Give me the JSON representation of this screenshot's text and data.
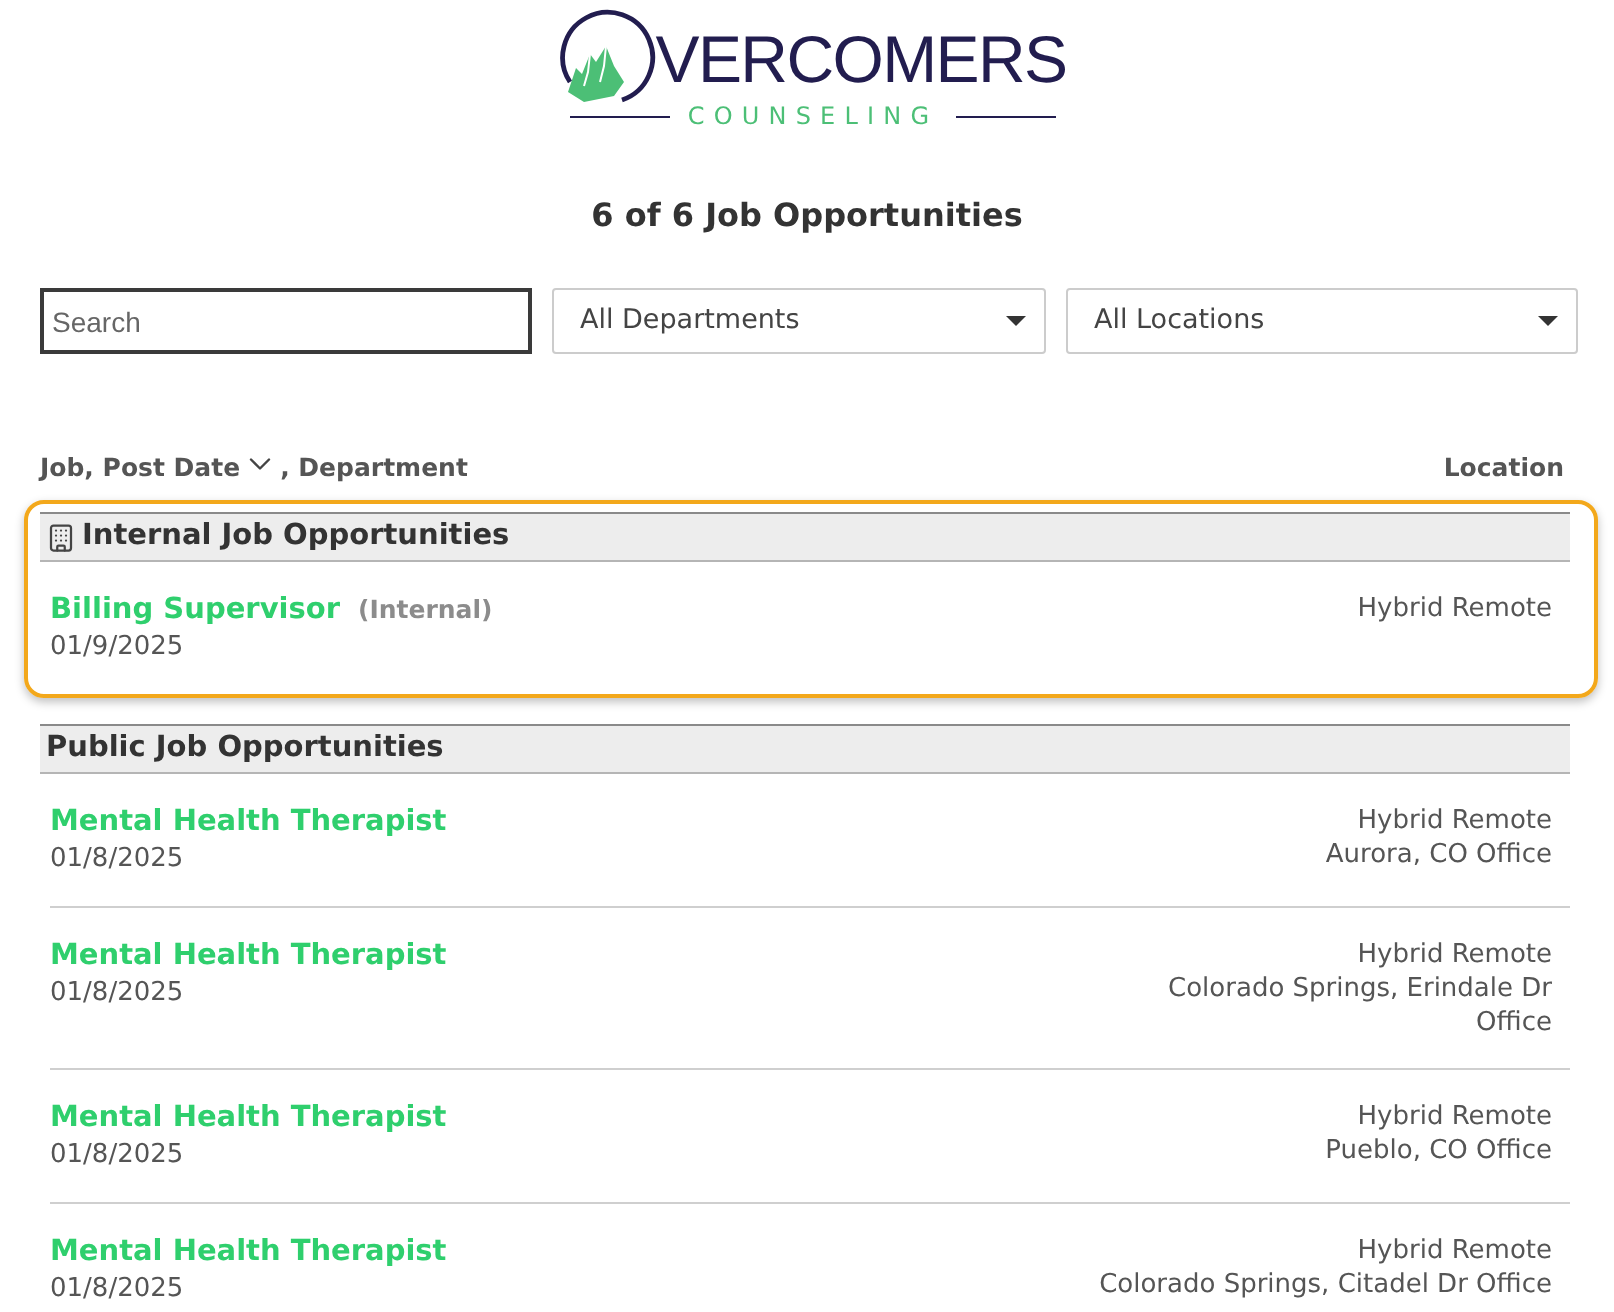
{
  "logo": {
    "wordmark": "VERCOMERS",
    "tagline": "COUNSELING"
  },
  "heading": "6 of 6 Job Opportunities",
  "filters": {
    "search": {
      "placeholder": "Search"
    },
    "department": {
      "value": "All Departments"
    },
    "location": {
      "value": "All Locations"
    }
  },
  "columns": {
    "left": [
      "Job, Post Date",
      ", Department"
    ],
    "right": "Location"
  },
  "sections": [
    {
      "kind": "internal",
      "title": "Internal Job Opportunities",
      "highlighted": true,
      "jobs": [
        {
          "title": "Billing Supervisor",
          "tag": "(Internal)",
          "date": "01/9/2025",
          "locations": [
            "Hybrid Remote"
          ]
        }
      ]
    },
    {
      "kind": "public",
      "title": "Public Job Opportunities",
      "highlighted": false,
      "jobs": [
        {
          "title": "Mental Health Therapist",
          "date": "01/8/2025",
          "locations": [
            "Hybrid Remote",
            "Aurora, CO Office"
          ]
        },
        {
          "title": "Mental Health Therapist",
          "date": "01/8/2025",
          "locations": [
            "Hybrid Remote",
            "Colorado Springs, Erindale Dr Office"
          ]
        },
        {
          "title": "Mental Health Therapist",
          "date": "01/8/2025",
          "locations": [
            "Hybrid Remote",
            "Pueblo, CO Office"
          ]
        },
        {
          "title": "Mental Health Therapist",
          "date": "01/8/2025",
          "locations": [
            "Hybrid Remote",
            "Colorado Springs, Citadel Dr Office"
          ]
        }
      ]
    }
  ]
}
